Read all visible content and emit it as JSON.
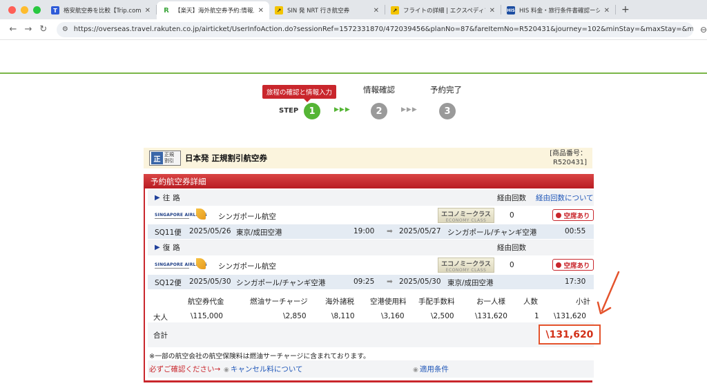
{
  "browser": {
    "tabs": [
      {
        "favicon": "T",
        "favicon_color": "#2e5bd8",
        "title": "格安航空券を比較【Trip.com】直",
        "active": false
      },
      {
        "favicon": "R",
        "favicon_color": "#3da63d",
        "title": "【楽天】海外航空券予約:情報入力",
        "active": true
      },
      {
        "favicon": "↗",
        "favicon_color": "#f3c400",
        "title": "SIN 発 NRT 行き航空券",
        "active": false
      },
      {
        "favicon": "↗",
        "favicon_color": "#f3c400",
        "title": "フライトの詳細 | エクスペディア",
        "active": false
      },
      {
        "favicon": "HIS",
        "favicon_color": "#1c4da1",
        "title": "HIS 料金・旅行条件書確認ーシン",
        "active": false
      }
    ],
    "close_glyph": "✕",
    "new_tab": "+",
    "url": "https://overseas.travel.rakuten.co.jp/airticket/UserInfoAction.do?sessionRef=1572331870/472039456&planNo=87&fareItemNo=R520431&journey=102&minStay=&maxStay=&maxStayType=&..."
  },
  "steps": {
    "current_label": "旅程の確認と情報入力",
    "word": "STEP",
    "items": [
      {
        "num": "1",
        "label": ""
      },
      {
        "num": "2",
        "label": "情報確認"
      },
      {
        "num": "3",
        "label": "予約完了"
      }
    ],
    "arrows": "▶▶▶",
    "colors": {
      "current": "#55b535",
      "pending": "#9a9a9a"
    }
  },
  "product": {
    "badge_icon": "正",
    "badge_text_1": "正規",
    "badge_text_2": "割引",
    "title": "日本発 正規割引航空券",
    "number_label": "[商品番号：",
    "number_value": "R520431]"
  },
  "details": {
    "header": "予約航空券詳細",
    "stops_label": "経由回数",
    "stops_link": "経由回数について",
    "outbound": {
      "label": "往路",
      "airline_logo_text": "SINGAPORE AIRLINES",
      "airline": "シンガポール航空",
      "class_jp": "エコノミークラス",
      "class_en": "ECONOMY CLASS",
      "stops": "0",
      "seat": "空席あり",
      "flight": "SQ11便",
      "dep_date": "2025/05/26",
      "dep_airport": "東京/成田空港",
      "dep_time": "19:00",
      "arr_date": "2025/05/27",
      "arr_airport": "シンガポール/チャンギ空港",
      "arr_time": "00:55"
    },
    "inbound": {
      "label": "復路",
      "airline_logo_text": "SINGAPORE AIRLINES",
      "airline": "シンガポール航空",
      "class_jp": "エコノミークラス",
      "class_en": "ECONOMY CLASS",
      "stops": "0",
      "seat": "空席あり",
      "flight": "SQ12便",
      "dep_date": "2025/05/30",
      "dep_airport": "シンガポール/チャンギ空港",
      "dep_time": "09:25",
      "arr_date": "2025/05/30",
      "arr_airport": "東京/成田空港",
      "arr_time": "17:30"
    },
    "price_headers": [
      "航空券代金",
      "燃油サーチャージ",
      "海外諸税",
      "空港使用料",
      "手配手数料",
      "お一人様",
      "人数",
      "小計"
    ],
    "price_row": {
      "type": "大人",
      "values": [
        "\\115,000",
        "\\2,850",
        "\\8,110",
        "\\3,160",
        "\\2,500",
        "\\131,620",
        "1",
        "\\131,620"
      ]
    },
    "total_label": "合計",
    "total_value": "\\131,620",
    "note": "※一部の航空会社の航空保険料は燃油サーチャージに含まれております。",
    "confirm_text": "必ずご確認ください→",
    "cancel_link": "キャンセル料について",
    "conditions_link": "適用条件"
  },
  "colors": {
    "accent_red": "#c9262c",
    "link_blue": "#1f56b8",
    "green_line": "#7ab648",
    "annotation": "#e4532c"
  }
}
